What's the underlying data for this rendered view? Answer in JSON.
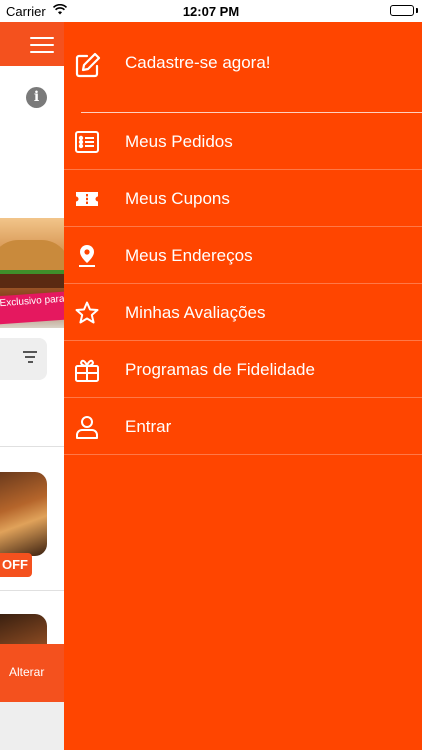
{
  "status_bar": {
    "carrier": "Carrier",
    "time": "12:07 PM"
  },
  "background_app": {
    "banner_text": "Exclusivo para pedidos Online",
    "discount_badge": "OFF",
    "alterar_label": "Alterar"
  },
  "drawer": {
    "signup": {
      "label": "Cadastre-se agora!",
      "icon": "edit-icon"
    },
    "items": [
      {
        "label": "Meus Pedidos",
        "icon": "list-icon"
      },
      {
        "label": "Meus Cupons",
        "icon": "ticket-icon"
      },
      {
        "label": "Meus Endereços",
        "icon": "location-pin-icon"
      },
      {
        "label": "Minhas Avaliações",
        "icon": "star-icon"
      },
      {
        "label": "Programas de Fidelidade",
        "icon": "gift-icon"
      },
      {
        "label": "Entrar",
        "icon": "user-icon"
      }
    ]
  },
  "colors": {
    "drawer_bg": "#ff4500",
    "accent": "#f4511e",
    "text_on_accent": "#ffffff"
  }
}
